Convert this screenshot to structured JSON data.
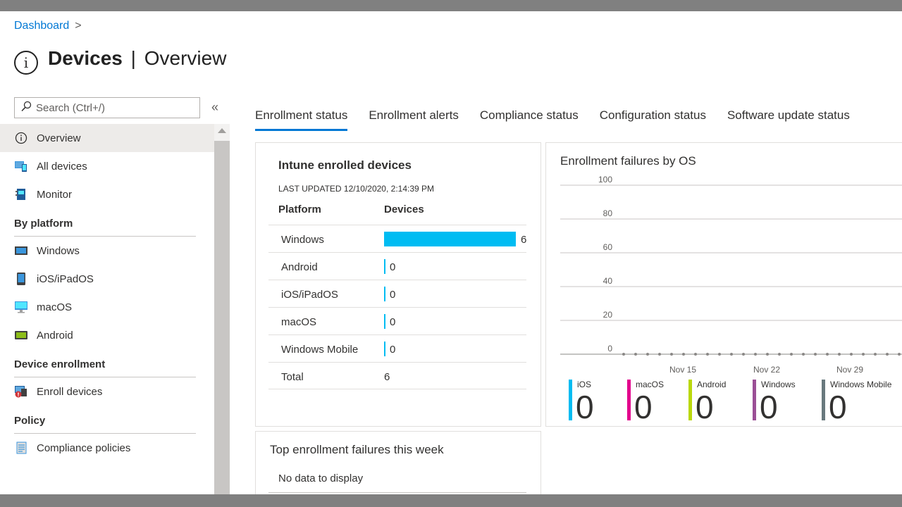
{
  "breadcrumb": {
    "root": "Dashboard",
    "separator": ">"
  },
  "header": {
    "title_bold": "Devices",
    "title_sep": "|",
    "title_rest": "Overview"
  },
  "search": {
    "placeholder": "Search (Ctrl+/)"
  },
  "collapse_glyph": "«",
  "sidebar": {
    "items": [
      {
        "label": "Overview",
        "icon": "info-icon",
        "active": true
      },
      {
        "label": "All devices",
        "icon": "all-devices-icon"
      },
      {
        "label": "Monitor",
        "icon": "monitor-icon"
      }
    ],
    "sections": [
      {
        "heading": "By platform",
        "items": [
          {
            "label": "Windows",
            "icon": "windows-device-icon"
          },
          {
            "label": "iOS/iPadOS",
            "icon": "ios-device-icon"
          },
          {
            "label": "macOS",
            "icon": "macos-device-icon"
          },
          {
            "label": "Android",
            "icon": "android-device-icon"
          }
        ]
      },
      {
        "heading": "Device enrollment",
        "items": [
          {
            "label": "Enroll devices",
            "icon": "enroll-devices-icon"
          }
        ]
      },
      {
        "heading": "Policy",
        "items": [
          {
            "label": "Compliance policies",
            "icon": "compliance-policies-icon"
          }
        ]
      }
    ]
  },
  "tabs": [
    {
      "label": "Enrollment status",
      "active": true
    },
    {
      "label": "Enrollment alerts"
    },
    {
      "label": "Compliance status"
    },
    {
      "label": "Configuration status"
    },
    {
      "label": "Software update status"
    }
  ],
  "enrolled_card": {
    "title": "Intune enrolled devices",
    "last_updated": "LAST UPDATED 12/10/2020, 2:14:39 PM",
    "columns": [
      "Platform",
      "Devices"
    ],
    "rows": [
      {
        "platform": "Windows",
        "devices": "6"
      },
      {
        "platform": "Android",
        "devices": "0"
      },
      {
        "platform": "iOS/iPadOS",
        "devices": "0"
      },
      {
        "platform": "macOS",
        "devices": "0"
      },
      {
        "platform": "Windows Mobile",
        "devices": "0"
      }
    ],
    "total_label": "Total",
    "total_value": "6",
    "bar_color": "#00bcf2"
  },
  "failures_card": {
    "title": "Top enrollment failures this week",
    "empty_text": "No data to display"
  },
  "chart_data": {
    "type": "line",
    "title": "Enrollment failures by OS",
    "y_ticks": [
      "0",
      "20",
      "40",
      "60",
      "80",
      "100"
    ],
    "ylim": [
      0,
      100
    ],
    "x_tick_labels": [
      "Nov 15",
      "Nov 22",
      "Nov 29"
    ],
    "points_count": 24,
    "series_values": 0,
    "series": [
      {
        "name": "iOS",
        "total": "0",
        "color": "#00bcf2"
      },
      {
        "name": "macOS",
        "total": "0",
        "color": "#e3008c"
      },
      {
        "name": "Android",
        "total": "0",
        "color": "#bad80a"
      },
      {
        "name": "Windows",
        "total": "0",
        "color": "#9b4f96"
      },
      {
        "name": "Windows Mobile",
        "total": "0",
        "color": "#69797e"
      }
    ],
    "grid": true
  }
}
